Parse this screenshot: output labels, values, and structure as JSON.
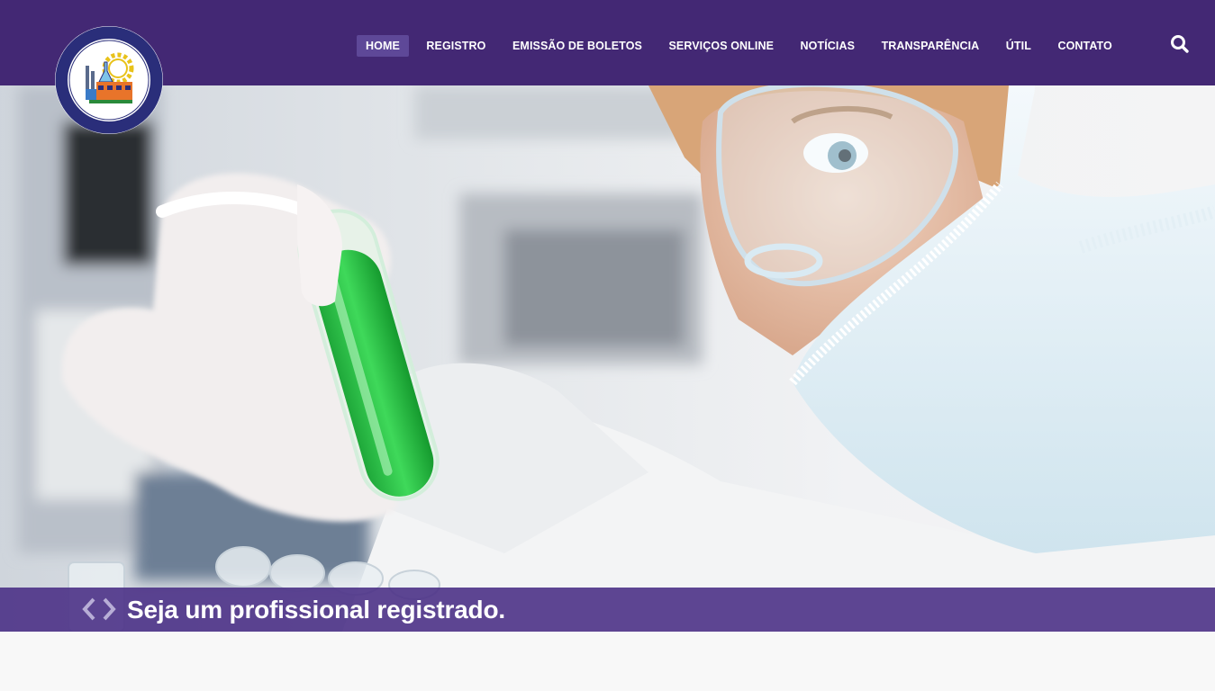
{
  "brand": {
    "logo_icon": "crq-seal-icon",
    "colors": {
      "header": "#432874",
      "active_nav": "#5e4898",
      "caption_bar": "#482c84",
      "text": "#ffffff"
    }
  },
  "nav": {
    "items": [
      {
        "label": "HOME",
        "active": true
      },
      {
        "label": "REGISTRO",
        "active": false
      },
      {
        "label": "EMISSÃO DE BOLETOS",
        "active": false
      },
      {
        "label": "SERVIÇOS ONLINE",
        "active": false
      },
      {
        "label": "NOTÍCIAS",
        "active": false
      },
      {
        "label": "TRANSPARÊNCIA",
        "active": false
      },
      {
        "label": "ÚTIL",
        "active": false
      },
      {
        "label": "CONTATO",
        "active": false
      }
    ],
    "search_icon": "search-icon"
  },
  "hero": {
    "image": "scientist-holding-green-test-tube",
    "caption": "Seja um profissional registrado.",
    "prev_icon": "chevron-left-icon",
    "next_icon": "chevron-right-icon"
  }
}
